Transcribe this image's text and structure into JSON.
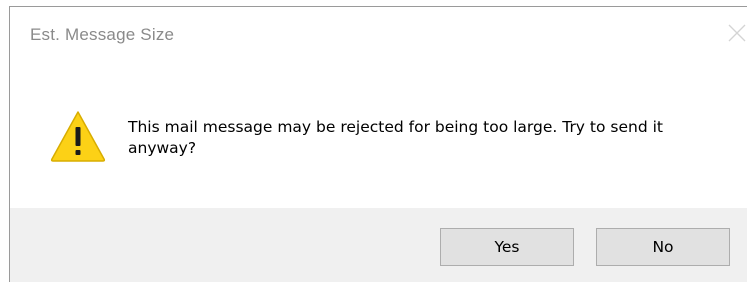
{
  "dialog": {
    "title": "Est. Message Size",
    "message": "This mail message may be rejected for being too large. Try to send it anyway?",
    "icon": "warning-icon",
    "buttons": {
      "yes_label": "Yes",
      "no_label": "No"
    }
  },
  "colors": {
    "title_text": "#8a8a8a",
    "footer_bg": "#f0f0f0",
    "button_bg": "#e1e1e1",
    "button_border": "#adadad",
    "warning_fill": "#fcd116",
    "warning_outline": "#c9a100"
  }
}
